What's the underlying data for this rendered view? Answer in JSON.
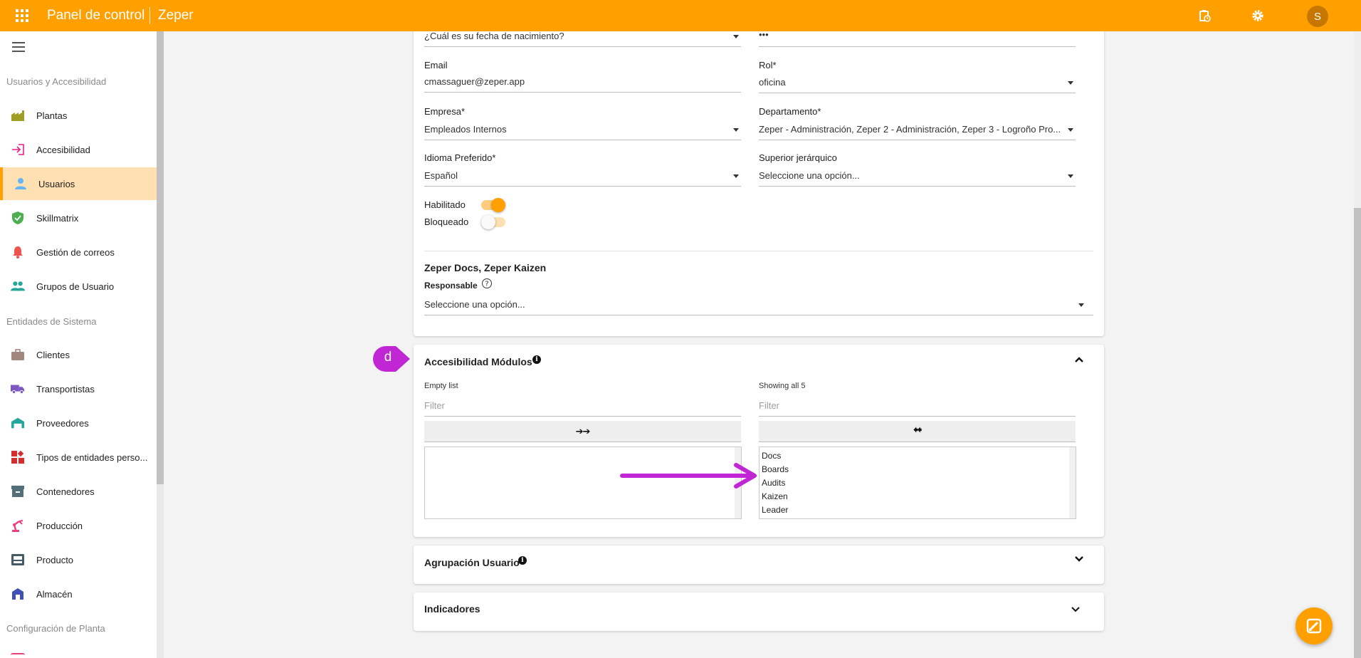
{
  "topbar": {
    "title": "Panel de control",
    "subtitle": "Zeper",
    "avatar_initial": "S",
    "accent_color": "#ffa000"
  },
  "sidebar": {
    "sections": [
      {
        "title": "Usuarios y Accesibilidad"
      },
      {
        "title": "Entidades de Sistema"
      },
      {
        "title": "Configuración de Planta"
      }
    ],
    "items": [
      {
        "label": "Plantas",
        "icon": "factory-icon"
      },
      {
        "label": "Accesibilidad",
        "icon": "login-icon"
      },
      {
        "label": "Usuarios",
        "icon": "person-icon",
        "active": true
      },
      {
        "label": "Skillmatrix",
        "icon": "shield-check-icon"
      },
      {
        "label": "Gestión de correos",
        "icon": "bell-icon"
      },
      {
        "label": "Grupos de Usuario",
        "icon": "people-icon"
      },
      {
        "label": "Clientes",
        "icon": "briefcase-icon"
      },
      {
        "label": "Transportistas",
        "icon": "truck-icon"
      },
      {
        "label": "Proveedores",
        "icon": "warehouse-icon"
      },
      {
        "label": "Tipos de entidades perso...",
        "icon": "widgets-icon"
      },
      {
        "label": "Contenedores",
        "icon": "archive-icon"
      },
      {
        "label": "Producción",
        "icon": "robot-arm-icon"
      },
      {
        "label": "Producto",
        "icon": "inbox-icon"
      },
      {
        "label": "Almacén",
        "icon": "store-icon"
      }
    ]
  },
  "form": {
    "birthdate_value": "¿Cuál es su fecha de nacimiento?",
    "password_value": "•••",
    "email_label": "Email",
    "email_value": "cmassaguer@zeper.app",
    "rol_label": "Rol*",
    "rol_value": "oficina",
    "empresa_label": "Empresa*",
    "empresa_value": "Empleados Internos",
    "departamento_label": "Departamento*",
    "departamento_value": "Zeper - Administración, Zeper 2 - Administración, Zeper 3 - Logroño Pro...",
    "idioma_label": "Idioma Preferido*",
    "idioma_value": "Español",
    "superior_label": "Superior jerárquico",
    "superior_value": "Seleccione una opción...",
    "habilitado_label": "Habilitado",
    "habilitado_on": true,
    "bloqueado_label": "Bloqueado",
    "bloqueado_on": false,
    "docs_section_title": "Zeper Docs, Zeper Kaizen",
    "responsable_label": "Responsable",
    "responsable_value": "Seleccione una opción..."
  },
  "accesibilidad": {
    "title": "Accesibilidad Módulos",
    "left_header": "Empty list",
    "right_header": "Showing all 5",
    "left_filter_placeholder": "Filter",
    "right_filter_placeholder": "Filter",
    "move_all_right_label": "➔➔",
    "move_all_left_label": "🠸🠸",
    "right_options": [
      "Docs",
      "Boards",
      "Audits",
      "Kaizen",
      "Leader"
    ]
  },
  "agrupacion": {
    "title": "Agrupación Usuario"
  },
  "indicadores": {
    "title": "Indicadores"
  },
  "annotation": {
    "badge_label": "d",
    "badge_color": "#c026d3",
    "arrow_color": "#c026d3"
  }
}
